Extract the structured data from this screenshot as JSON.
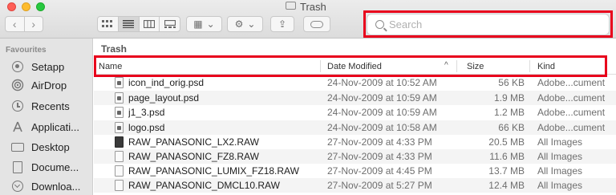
{
  "window": {
    "title": "Trash"
  },
  "toolbar": {
    "back_glyph": "‹",
    "forward_glyph": "›",
    "view_icons": [
      "icon-view-icon",
      "list-view-icon",
      "column-view-icon",
      "gallery-view-icon"
    ],
    "group_glyph": "▦",
    "action_glyph": "⚙",
    "chevron_glyph": "⌄",
    "share_glyph": "⇪"
  },
  "search": {
    "placeholder": "Search",
    "value": ""
  },
  "sidebar": {
    "heading": "Favourites",
    "items": [
      {
        "label": "Setapp",
        "icon": "setapp-icon"
      },
      {
        "label": "AirDrop",
        "icon": "airdrop-icon"
      },
      {
        "label": "Recents",
        "icon": "recents-clock-icon"
      },
      {
        "label": "Applicati...",
        "icon": "applications-icon"
      },
      {
        "label": "Desktop",
        "icon": "desktop-icon"
      },
      {
        "label": "Docume...",
        "icon": "documents-icon"
      },
      {
        "label": "Downloa...",
        "icon": "downloads-icon"
      }
    ]
  },
  "main": {
    "path_title": "Trash",
    "columns": {
      "name": "Name",
      "date": "Date Modified",
      "size": "Size",
      "kind": "Kind",
      "sort_glyph": "^"
    },
    "rows": [
      {
        "name": "icon_ind_orig.psd",
        "date": "24-Nov-2009 at 10:52 AM",
        "size": "56 KB",
        "kind": "Adobe...cument",
        "icon": "psd-file-icon"
      },
      {
        "name": "page_layout.psd",
        "date": "24-Nov-2009 at 10:59 AM",
        "size": "1.9 MB",
        "kind": "Adobe...cument",
        "icon": "psd-file-icon"
      },
      {
        "name": "j1_3.psd",
        "date": "24-Nov-2009 at 10:59 AM",
        "size": "1.2 MB",
        "kind": "Adobe...cument",
        "icon": "psd-file-icon"
      },
      {
        "name": "logo.psd",
        "date": "24-Nov-2009 at 10:58 AM",
        "size": "66 KB",
        "kind": "Adobe...cument",
        "icon": "psd-file-icon"
      },
      {
        "name": "RAW_PANASONIC_LX2.RAW",
        "date": "27-Nov-2009 at 4:33 PM",
        "size": "20.5 MB",
        "kind": "All Images",
        "icon": "raw-image-file-icon"
      },
      {
        "name": "RAW_PANASONIC_FZ8.RAW",
        "date": "27-Nov-2009 at 4:33 PM",
        "size": "11.6 MB",
        "kind": "All Images",
        "icon": "raw-file-icon"
      },
      {
        "name": "RAW_PANASONIC_LUMIX_FZ18.RAW",
        "date": "27-Nov-2009 at 4:45 PM",
        "size": "13.7 MB",
        "kind": "All Images",
        "icon": "raw-file-icon"
      },
      {
        "name": "RAW_PANASONIC_DMCL10.RAW",
        "date": "27-Nov-2009 at 5:27 PM",
        "size": "12.4 MB",
        "kind": "All Images",
        "icon": "raw-file-icon"
      }
    ]
  },
  "colors": {
    "highlight": "#e8001c",
    "sidebar_bg": "#e4e4e4",
    "toolbar_bg": "#dcdcdc"
  }
}
